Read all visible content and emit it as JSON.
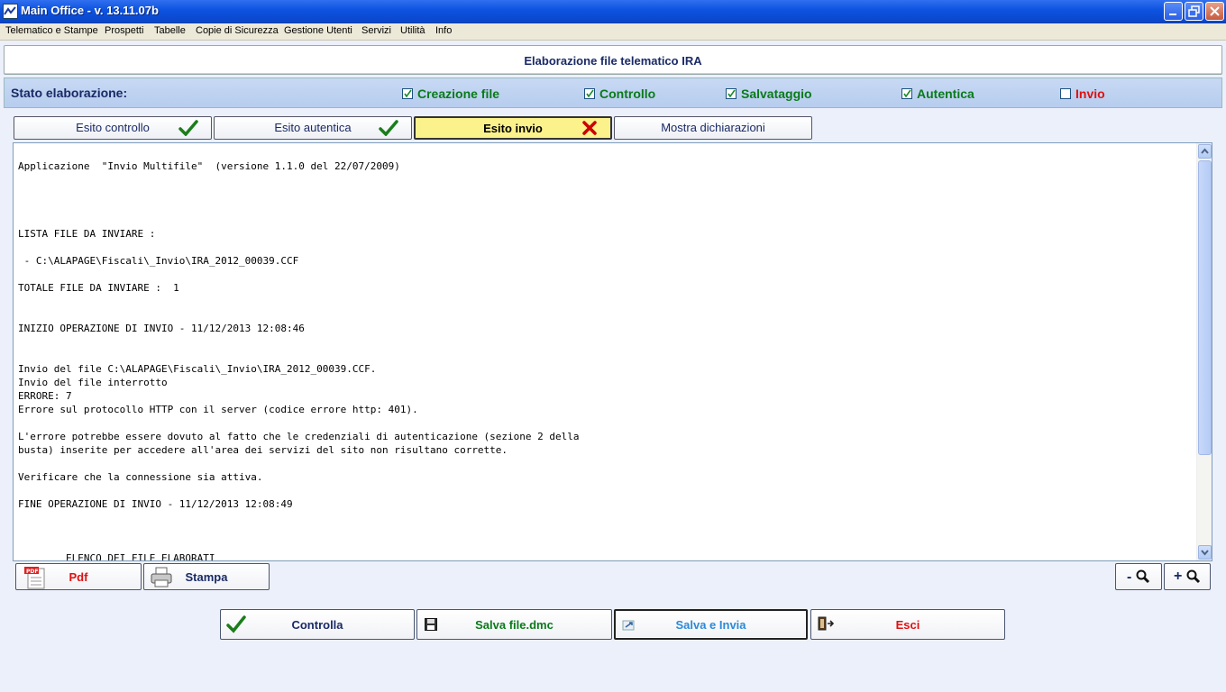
{
  "window": {
    "title": "Main Office - v. 13.11.07b"
  },
  "menu": [
    "Telematico e Stampe",
    "Prospetti",
    "Tabelle",
    "Copie di Sicurezza",
    "Gestione Utenti",
    "Servizi",
    "Utilità",
    "Info"
  ],
  "header": {
    "title": "Elaborazione file telematico IRA"
  },
  "stato": {
    "label": "Stato elaborazione:",
    "steps": [
      {
        "label": "Creazione file",
        "checked": true
      },
      {
        "label": "Controllo",
        "checked": true
      },
      {
        "label": "Salvataggio",
        "checked": true
      },
      {
        "label": "Autentica",
        "checked": true
      },
      {
        "label": "Invio",
        "checked": false
      }
    ]
  },
  "tabs": [
    {
      "label": "Esito controllo",
      "status": "ok"
    },
    {
      "label": "Esito autentica",
      "status": "ok"
    },
    {
      "label": "Esito invio",
      "status": "error",
      "active": true
    },
    {
      "label": "Mostra dichiarazioni"
    }
  ],
  "log_text": "Applicazione  \"Invio Multifile\"  (versione 1.1.0 del 22/07/2009)\n\n\n\n\nLISTA FILE DA INVIARE :\n\n - C:\\ALAPAGE\\Fiscali\\_Invio\\IRA_2012_00039.CCF\n\nTOTALE FILE DA INVIARE :  1\n\n\nINIZIO OPERAZIONE DI INVIO - 11/12/2013 12:08:46\n\n\nInvio del file C:\\ALAPAGE\\Fiscali\\_Invio\\IRA_2012_00039.CCF.\nInvio del file interrotto\nERRORE: 7\nErrore sul protocollo HTTP con il server (codice errore http: 401).\n\nL'errore potrebbe essere dovuto al fatto che le credenziali di autenticazione (sezione 2 della\nbusta) inserite per accedere all'area dei servizi del sito non risultano corrette.\n\nVerificare che la connessione sia attiva.\n\nFINE OPERAZIONE DI INVIO - 11/12/2013 12:08:49\n\n\n\n        ELENCO DEI FILE ELABORATI",
  "output_buttons": {
    "pdf": "Pdf",
    "stampa": "Stampa",
    "zoom_out": "-",
    "zoom_in": "+"
  },
  "actions": {
    "controlla": "Controlla",
    "salva": "Salva file.dmc",
    "salva_invia": "Salva e Invia",
    "esci": "Esci"
  },
  "colors": {
    "ok": "#0a7a1a",
    "error": "#e01010",
    "accent": "#1a2a66"
  }
}
